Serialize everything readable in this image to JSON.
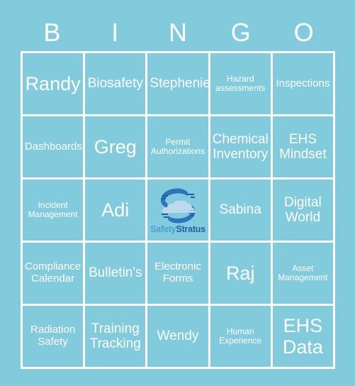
{
  "card": {
    "title": "BINGO",
    "header_letters": [
      "B",
      "I",
      "N",
      "G",
      "O"
    ],
    "colors": {
      "background": "#82cbdc",
      "cell_fill": "#82cbdc",
      "grid_line": "#ffffff",
      "cell_text": "#ffffff",
      "logo_dark_blue": "#1f5fa9",
      "logo_mid_blue": "#2e74bd",
      "logo_light_blue": "#bcd9ee",
      "logo_word_safety": "#4b9fd5",
      "logo_word_stratus": "#1f5fa9"
    },
    "grid": {
      "columns": 5,
      "rows": 5,
      "cells": [
        {
          "label": "Randy",
          "size": "xl"
        },
        {
          "label": "Biosafety",
          "size": "lg"
        },
        {
          "label": "Stephenie",
          "size": "lg"
        },
        {
          "label": "Hazard\nassessments",
          "size": "sm"
        },
        {
          "label": "Inspections",
          "size": "md"
        },
        {
          "label": "Dashboards",
          "size": "md"
        },
        {
          "label": "Greg",
          "size": "xl"
        },
        {
          "label": "Permit\nAuthorizations",
          "size": "sm"
        },
        {
          "label": "Chemical\nInventory",
          "size": "lg"
        },
        {
          "label": "EHS\nMindset",
          "size": "lg"
        },
        {
          "label": "Incident\nManagement",
          "size": "sm"
        },
        {
          "label": "Adi",
          "size": "xl"
        },
        {
          "label": "",
          "size": "md",
          "free_space": true
        },
        {
          "label": "Sabina",
          "size": "lg"
        },
        {
          "label": "Digital\nWorld",
          "size": "lg"
        },
        {
          "label": "Compliance\nCalendar",
          "size": "md"
        },
        {
          "label": "Bulletin's",
          "size": "lg"
        },
        {
          "label": "Electronic\nForms",
          "size": "md"
        },
        {
          "label": "Raj",
          "size": "xl"
        },
        {
          "label": "Asset\nManagement",
          "size": "sm"
        },
        {
          "label": "Radiation\nSafety",
          "size": "md"
        },
        {
          "label": "Training\nTracking",
          "size": "lg"
        },
        {
          "label": "Wendy",
          "size": "lg"
        },
        {
          "label": "Human\nExperience",
          "size": "sm"
        },
        {
          "label": "EHS\nData",
          "size": "xl"
        }
      ]
    },
    "free_space": {
      "logo_icon_name": "safetystratus-cloud-logo",
      "wordmark_part_1": "Safety",
      "wordmark_part_2": "Stratus"
    }
  }
}
